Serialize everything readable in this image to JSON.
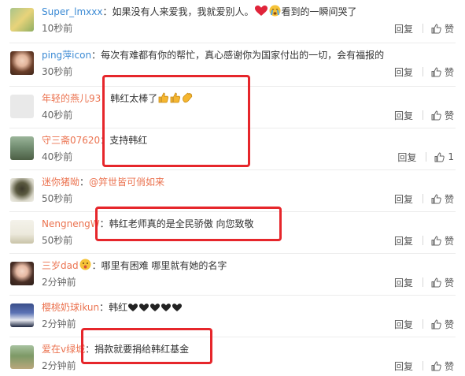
{
  "comments": [
    {
      "username": "Super_lmxxx",
      "text_a": "如果没有人来爱我，我就爱别人。",
      "text_b": "看到的一瞬间哭了",
      "time": "10秒前",
      "reply": "回复",
      "like": "赞"
    },
    {
      "username": "ping萍icon",
      "text": "每次有难都有你的帮忙，真心感谢你为国家付出的一切，会有福报的",
      "time": "30秒前",
      "reply": "回复",
      "like": "赞"
    },
    {
      "username": "年轻的燕儿93",
      "text": "韩红太棒了",
      "time": "40秒前",
      "reply": "回复",
      "like": "赞"
    },
    {
      "username": "守三斋07620",
      "text": "支持韩红",
      "time": "40秒前",
      "reply": "回复",
      "like": "1"
    },
    {
      "username": "迷你猪呦",
      "mention": "@笄世皆可俏如来",
      "time": "50秒前",
      "reply": "回复",
      "like": "赞"
    },
    {
      "username": "NengnengW",
      "text": "韩红老师真的是全民骄傲  向您致敬",
      "time": "50秒前",
      "reply": "回复",
      "like": "赞"
    },
    {
      "username": "三岁dad",
      "text": "哪里有困难 哪里就有她的名字",
      "time": "2分钟前",
      "reply": "回复",
      "like": "赞"
    },
    {
      "username": "樱桃奶球ikun",
      "text": "韩红",
      "time": "2分钟前",
      "reply": "回复",
      "like": "赞"
    },
    {
      "username": "爱在v绿城",
      "text": "捐款就要捐给韩红基金",
      "time": "2分钟前",
      "reply": "回复",
      "like": "赞"
    }
  ],
  "colors": {
    "username": "#eb7350",
    "username_blue": "#3b8ad4",
    "text": "#333333",
    "time": "#666666",
    "highlight": "#e6262b",
    "divider": "#ececec"
  },
  "icons": {
    "like": "thumbs-up-icon",
    "heart": "red-heart-emoji",
    "cry": "crying-face-emoji",
    "thumb": "thumbs-up-emoji",
    "clap": "clapping-hands-emoji",
    "black_heart": "black-heart-emoji",
    "wow": "surprised-face-emoji"
  }
}
